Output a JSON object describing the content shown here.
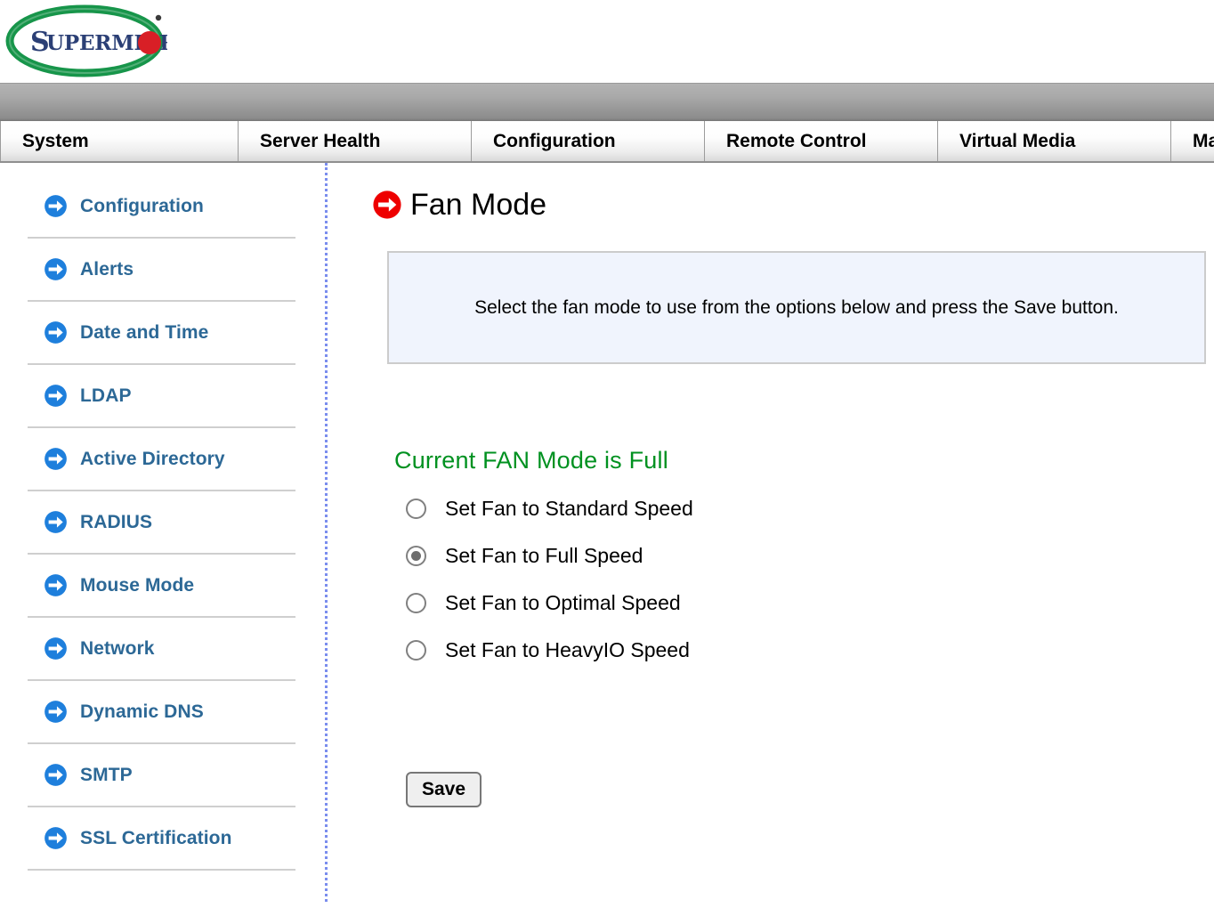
{
  "brand": {
    "logo_text": "SUPERMICRO",
    "logo_alt": "Supermicro logo"
  },
  "nav": {
    "tabs": [
      {
        "label": "System",
        "width_class": "w-system"
      },
      {
        "label": "Server Health",
        "width_class": "w-health"
      },
      {
        "label": "Configuration",
        "width_class": "w-config"
      },
      {
        "label": "Remote Control",
        "width_class": "w-remote"
      },
      {
        "label": "Virtual Media",
        "width_class": "w-virtual"
      },
      {
        "label": "Ma",
        "width_class": "w-maint"
      }
    ]
  },
  "sidebar": {
    "items": [
      {
        "label": "Configuration",
        "icon": "blue-arrow-circle-icon"
      },
      {
        "label": "Alerts",
        "icon": "blue-arrow-circle-icon"
      },
      {
        "label": "Date and Time",
        "icon": "blue-arrow-circle-icon"
      },
      {
        "label": "LDAP",
        "icon": "blue-arrow-circle-icon"
      },
      {
        "label": "Active Directory",
        "icon": "blue-arrow-circle-icon"
      },
      {
        "label": "RADIUS",
        "icon": "blue-arrow-circle-icon"
      },
      {
        "label": "Mouse Mode",
        "icon": "blue-arrow-circle-icon"
      },
      {
        "label": "Network",
        "icon": "blue-arrow-circle-icon"
      },
      {
        "label": "Dynamic DNS",
        "icon": "blue-arrow-circle-icon"
      },
      {
        "label": "SMTP",
        "icon": "blue-arrow-circle-icon"
      },
      {
        "label": "SSL Certification",
        "icon": "blue-arrow-circle-icon"
      }
    ]
  },
  "main": {
    "title": "Fan Mode",
    "title_icon": "red-arrow-circle-icon",
    "info_message": "Select the fan mode to use from the options below and press the Save button.",
    "current_mode_text": "Current FAN Mode is Full",
    "fan_options": [
      {
        "label": "Set Fan to Standard Speed",
        "selected": false
      },
      {
        "label": "Set Fan to Full Speed",
        "selected": true
      },
      {
        "label": "Set Fan to Optimal Speed",
        "selected": false
      },
      {
        "label": "Set Fan to HeavyIO Speed",
        "selected": false
      }
    ],
    "save_label": "Save"
  },
  "colors": {
    "sidebar_link": "#2c6896",
    "status_green": "#009120",
    "info_box_bg": "#f0f4fd",
    "title_icon_red": "#ee0000",
    "sidebar_icon_blue": "#1e7fdc",
    "logo_green": "#17954a",
    "logo_navy": "#2b3f75",
    "logo_red": "#d81f26"
  }
}
